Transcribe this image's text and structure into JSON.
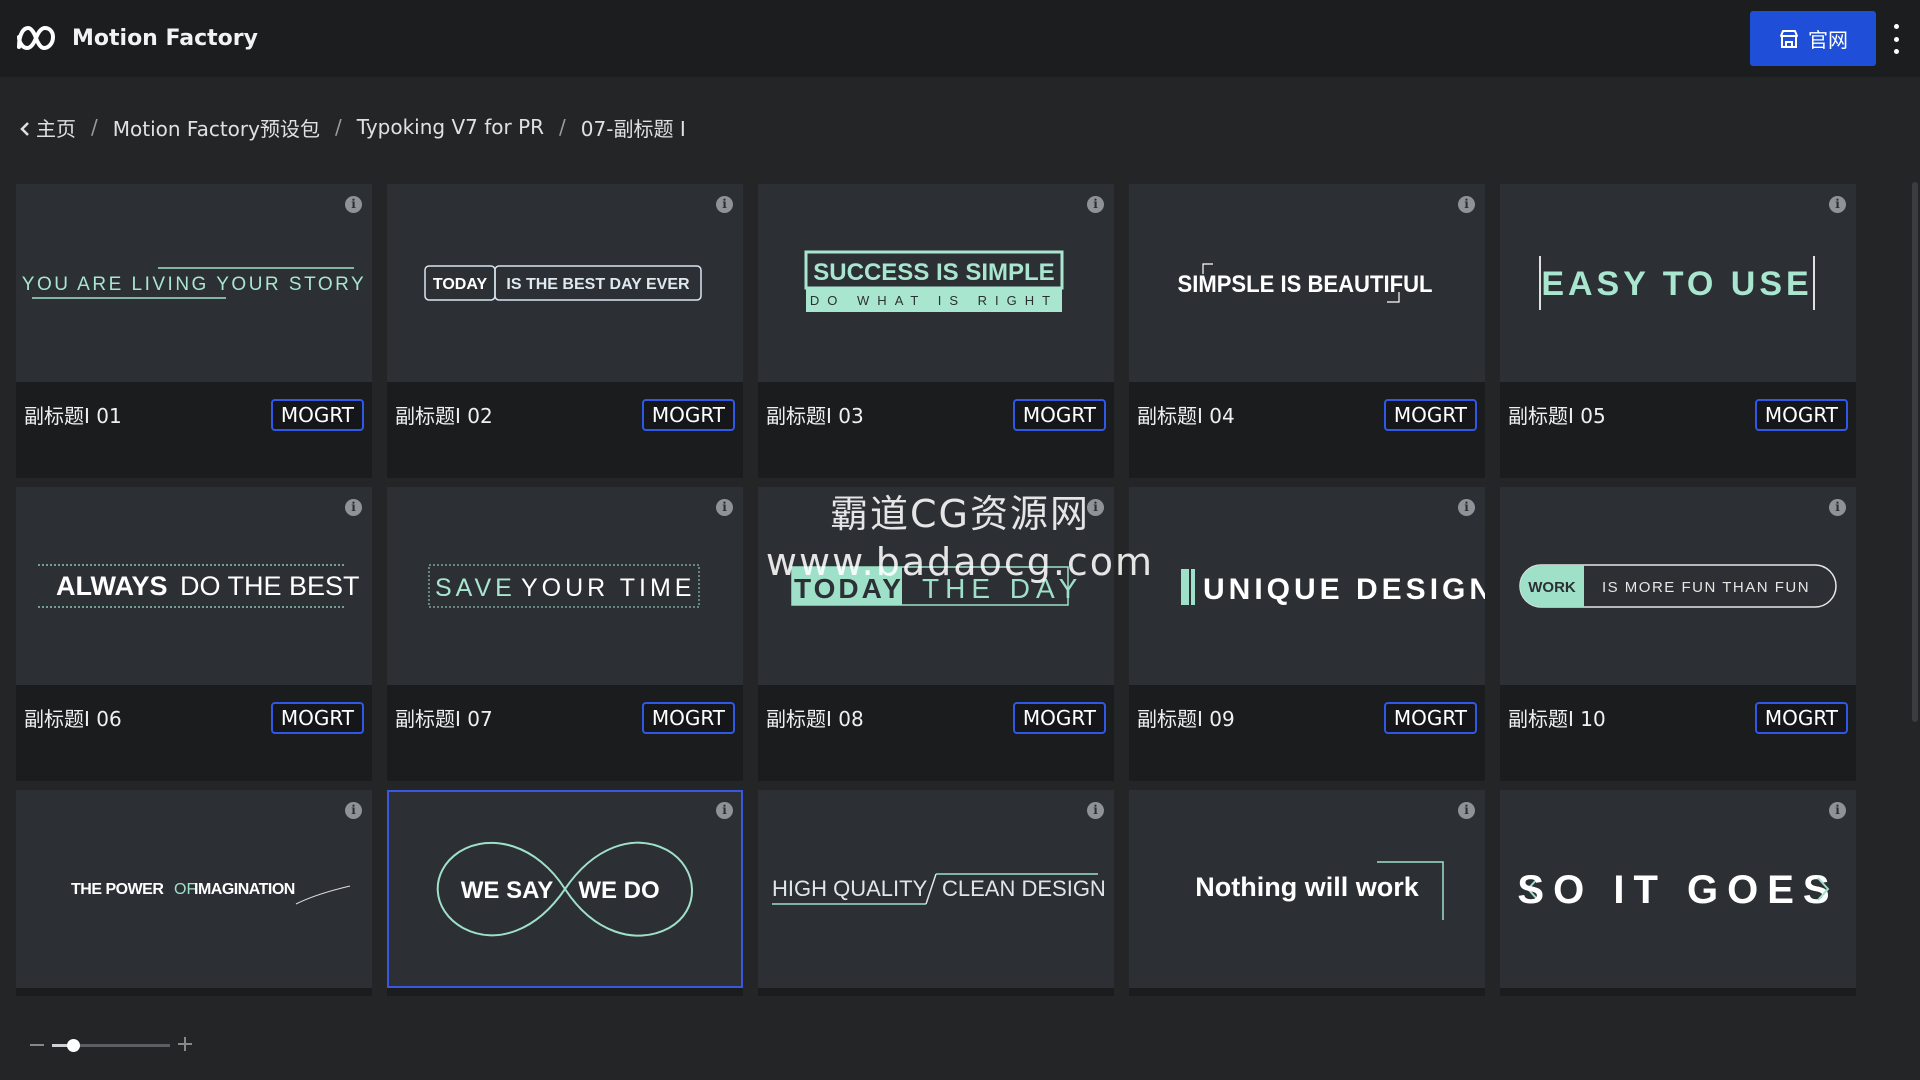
{
  "app": {
    "title": "Motion Factory",
    "site_button_label": "官网"
  },
  "breadcrumb": [
    "主页",
    "Motion Factory预设包",
    "Typoking V7 for PR",
    "07-副标题 I"
  ],
  "format_label": "MOGRT",
  "info_glyph": "i",
  "colors": {
    "accent": "#1f4fd8",
    "mogrt_border": "#2f58e6",
    "teal": "#9fe0c9"
  },
  "cards": [
    {
      "name": "副标题I 01",
      "art_text": [
        "YOU ARE LIVING YOUR STORY"
      ]
    },
    {
      "name": "副标题I 02",
      "art_text": [
        "TODAY",
        "IS THE BEST DAY EVER"
      ]
    },
    {
      "name": "副标题I 03",
      "art_text": [
        "SUCCESS IS SIMPLE",
        "DO WHAT IS RIGHT"
      ]
    },
    {
      "name": "副标题I 04",
      "art_text": [
        "SIMPSLE IS BEAUTIFUL"
      ]
    },
    {
      "name": "副标题I 05",
      "art_text": [
        "EASY  TO USE"
      ]
    },
    {
      "name": "副标题I 06",
      "art_text": [
        "ALWAYS",
        "DO THE BEST"
      ]
    },
    {
      "name": "副标题I 07",
      "art_text": [
        "SAVE",
        "YOUR TIME"
      ]
    },
    {
      "name": "副标题I 08",
      "art_text": [
        "TODAY",
        "THE DAY"
      ]
    },
    {
      "name": "副标题I 09",
      "art_text": [
        "UNIQUE DESIGN"
      ]
    },
    {
      "name": "副标题I 10",
      "art_text": [
        "WORK",
        "IS MORE FUN THAN FUN"
      ]
    },
    {
      "name": "",
      "art_text": [
        "THE POWER",
        "OF",
        "IMAGINATION"
      ]
    },
    {
      "name": "",
      "art_text": [
        "WE SAY",
        "WE DO"
      ]
    },
    {
      "name": "",
      "art_text": [
        "HIGH QUALITY",
        "CLEAN DESIGN"
      ]
    },
    {
      "name": "",
      "art_text": [
        "Nothing will work"
      ]
    },
    {
      "name": "",
      "art_text": [
        "SO IT GOES"
      ]
    }
  ],
  "zoom": {
    "level": 0.18
  },
  "watermark": {
    "line1": "霸道CG资源网",
    "line2": "www.badaocg.com"
  }
}
